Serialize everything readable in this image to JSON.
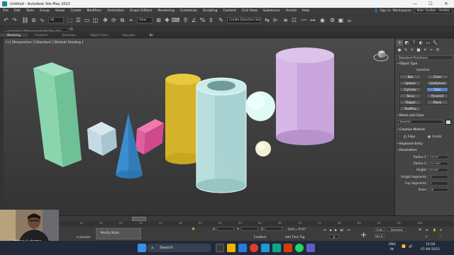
{
  "window": {
    "title": "Untitled - Autodesk 3ds Max 2022",
    "minimize": "—",
    "maximize": "☐",
    "close": "✕"
  },
  "menu": {
    "items": [
      "File",
      "Edit",
      "Tools",
      "Group",
      "Views",
      "Create",
      "Modifiers",
      "Animation",
      "Graph Editors",
      "Rendering",
      "Customize",
      "Scripting",
      "Content",
      "Civil View",
      "Substance",
      "Arnold",
      "Help"
    ],
    "signin": "Sign In",
    "workspaces_label": "Workspaces:",
    "workspace_value": "Main Toolbar - Heddic"
  },
  "toolbar": {
    "filter_value": "All",
    "refcoord_value": "View",
    "selection_set_placeholder": "Create Selection Set"
  },
  "path": {
    "value": "C:\\Users\\91976\\Documents\\3ds Max 2022"
  },
  "ribbon": {
    "tabs": [
      "Modeling",
      "Freeform",
      "Selection",
      "Object Paint",
      "Populate"
    ],
    "active": 0
  },
  "viewport": {
    "label": "[+] [Perspective ] [Standard ] [Default Shading ]"
  },
  "command_panel": {
    "category_value": "Standard Primitives",
    "object_type_header": "Object Type",
    "autogrid_label": "AutoGrid",
    "buttons": [
      "Box",
      "Cone",
      "Sphere",
      "GeoSphere",
      "Cylinder",
      "Tube",
      "Torus",
      "Pyramid",
      "Teapot",
      "Plane",
      "TextPlus"
    ],
    "selected_button": "Tube",
    "name_color_header": "Name and Color",
    "object_name": "Tube001",
    "object_color": "#bfe3d6",
    "creation_method_header": "Creation Method",
    "edge_label": "Edge",
    "center_label": "Center",
    "keyboard_entry_header": "Keyboard Entry",
    "parameters_header": "Parameters",
    "params": [
      {
        "label": "Radius 1:",
        "value": "29.53\""
      },
      {
        "label": "Radius 2:",
        "value": "22.128\""
      },
      {
        "label": "Height:",
        "value": "82.69\""
      },
      {
        "label": "Height Segments:",
        "value": "5"
      },
      {
        "label": "Cap Segments:",
        "value": "1"
      },
      {
        "label": "Sides:",
        "value": "18"
      }
    ]
  },
  "timeline": {
    "ticks": [
      "15",
      "20",
      "25",
      "30",
      "35",
      "40",
      "45",
      "50",
      "55",
      "60",
      "65",
      "70",
      "75",
      "80",
      "85",
      "90",
      "95",
      "100"
    ]
  },
  "status": {
    "lock_label": "Modify Mode",
    "x_label": "X:",
    "y_label": "Y:",
    "z_label": "Z:",
    "grid_label": "Grid = 0'10\"",
    "enabled_label": "Enabled:",
    "add_tag_label": "Add Time Tag",
    "auto_label": "Auto",
    "setk_label": "Set K.",
    "selected_value": "Selected",
    "frame_value": "0",
    "process_text": "e process"
  },
  "webcam": {
    "caption": "Heavy t-storms"
  },
  "taskbar": {
    "search_label": "Search",
    "lang_top": "ENG",
    "lang_bottom": "IN",
    "time": "15:58",
    "date": "07-09-2023"
  }
}
